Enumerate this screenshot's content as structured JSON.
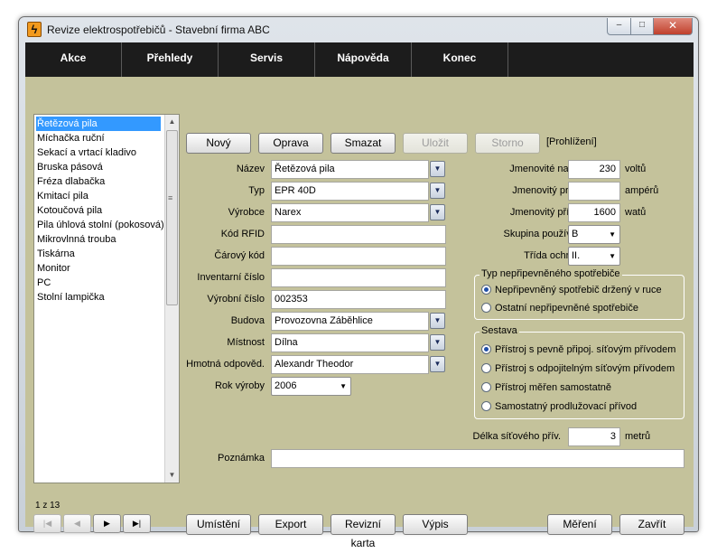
{
  "window": {
    "app_icon_glyph": "ϟ",
    "title": "Revize elektrospotřebičů - Stavební firma ABC",
    "controls": {
      "minimize": "–",
      "maximize": "□",
      "close": "✕"
    }
  },
  "menu": [
    "Akce",
    "Přehledy",
    "Servis",
    "Nápověda",
    "Konec"
  ],
  "list": {
    "items": [
      "Řetězová pila",
      "Míchačka ruční",
      "Sekací a vrtací kladivo",
      "Bruska pásová",
      "Fréza dlabačka",
      "Kmitací pila",
      "Kotoučová pila",
      "Pila úhlová stolní (pokosová)",
      "Mikrovlnná trouba",
      "Tiskárna",
      "Monitor",
      "PC",
      "Stolní lampička"
    ],
    "selected_index": 0,
    "counter": "1 z 13",
    "scroll": {
      "up": "▲",
      "down": "▼",
      "grip": "≡"
    }
  },
  "nav": {
    "first": "|◀",
    "prev": "◀",
    "next": "▶",
    "last": "▶|"
  },
  "toolbar": {
    "new": "Nový",
    "edit": "Oprava",
    "delete": "Smazat",
    "save": "Uložit",
    "cancel": "Storno",
    "mode": "[Prohlížení]"
  },
  "dropdown_glyph": "▼",
  "form": {
    "nazev": {
      "label": "Název",
      "value": "Řetězová pila"
    },
    "typ": {
      "label": "Typ",
      "value": "EPR 40D"
    },
    "vyrobce": {
      "label": "Výrobce",
      "value": "Narex"
    },
    "kod_rfid": {
      "label": "Kód RFID",
      "value": ""
    },
    "carovy_kod": {
      "label": "Čárový kód",
      "value": ""
    },
    "inventarni_cislo": {
      "label": "Inventarní číslo",
      "value": ""
    },
    "vyrobni_cislo": {
      "label": "Výrobní číslo",
      "value": "002353"
    },
    "budova": {
      "label": "Budova",
      "value": "Provozovna Záběhlice"
    },
    "mistnost": {
      "label": "Místnost",
      "value": "Dílna"
    },
    "hmotna_odpovednost": {
      "label": "Hmotná odpověd.",
      "value": "Alexandr Theodor"
    },
    "rok_vyroby": {
      "label": "Rok výroby",
      "value": "2006"
    },
    "poznamka": {
      "label": "Poznámka",
      "value": ""
    },
    "jmenovite_napeti": {
      "label": "Jmenovité napětí",
      "value": "230",
      "unit": "voltů"
    },
    "jmenovity_proud": {
      "label": "Jmenovitý proud",
      "value": "",
      "unit": "ampérů"
    },
    "jmenovity_prikon": {
      "label": "Jmenovitý příkon",
      "value": "1600",
      "unit": "watů"
    },
    "skupina_pouzivani": {
      "label": "Skupina používání",
      "value": "B"
    },
    "trida_ochrany": {
      "label": "Třída ochrany",
      "value": "II."
    },
    "delka_privodu": {
      "label": "Délka síťového přív.",
      "value": "3",
      "unit": "metrů"
    }
  },
  "typ_group": {
    "title": "Typ nepřipevněného spotřebiče",
    "options": [
      "Nepřipevněný spotřebič držený v ruce",
      "Ostatní nepřipevněné spotřebiče"
    ],
    "selected": 0
  },
  "sestava_group": {
    "title": "Sestava",
    "options": [
      "Přístroj s pevně připoj. síťovým přívodem",
      "Přístroj s odpojitelným síťovým přívodem",
      "Přístroj měřen samostatně",
      "Samostatný prodlužovací přívod"
    ],
    "selected": 0
  },
  "bottom_buttons": {
    "umisteni": "Umístění",
    "export": "Export",
    "revizni_karta": "Revizní karta",
    "vypis": "Výpis",
    "mereni": "Měření",
    "zavrit": "Zavřít"
  }
}
